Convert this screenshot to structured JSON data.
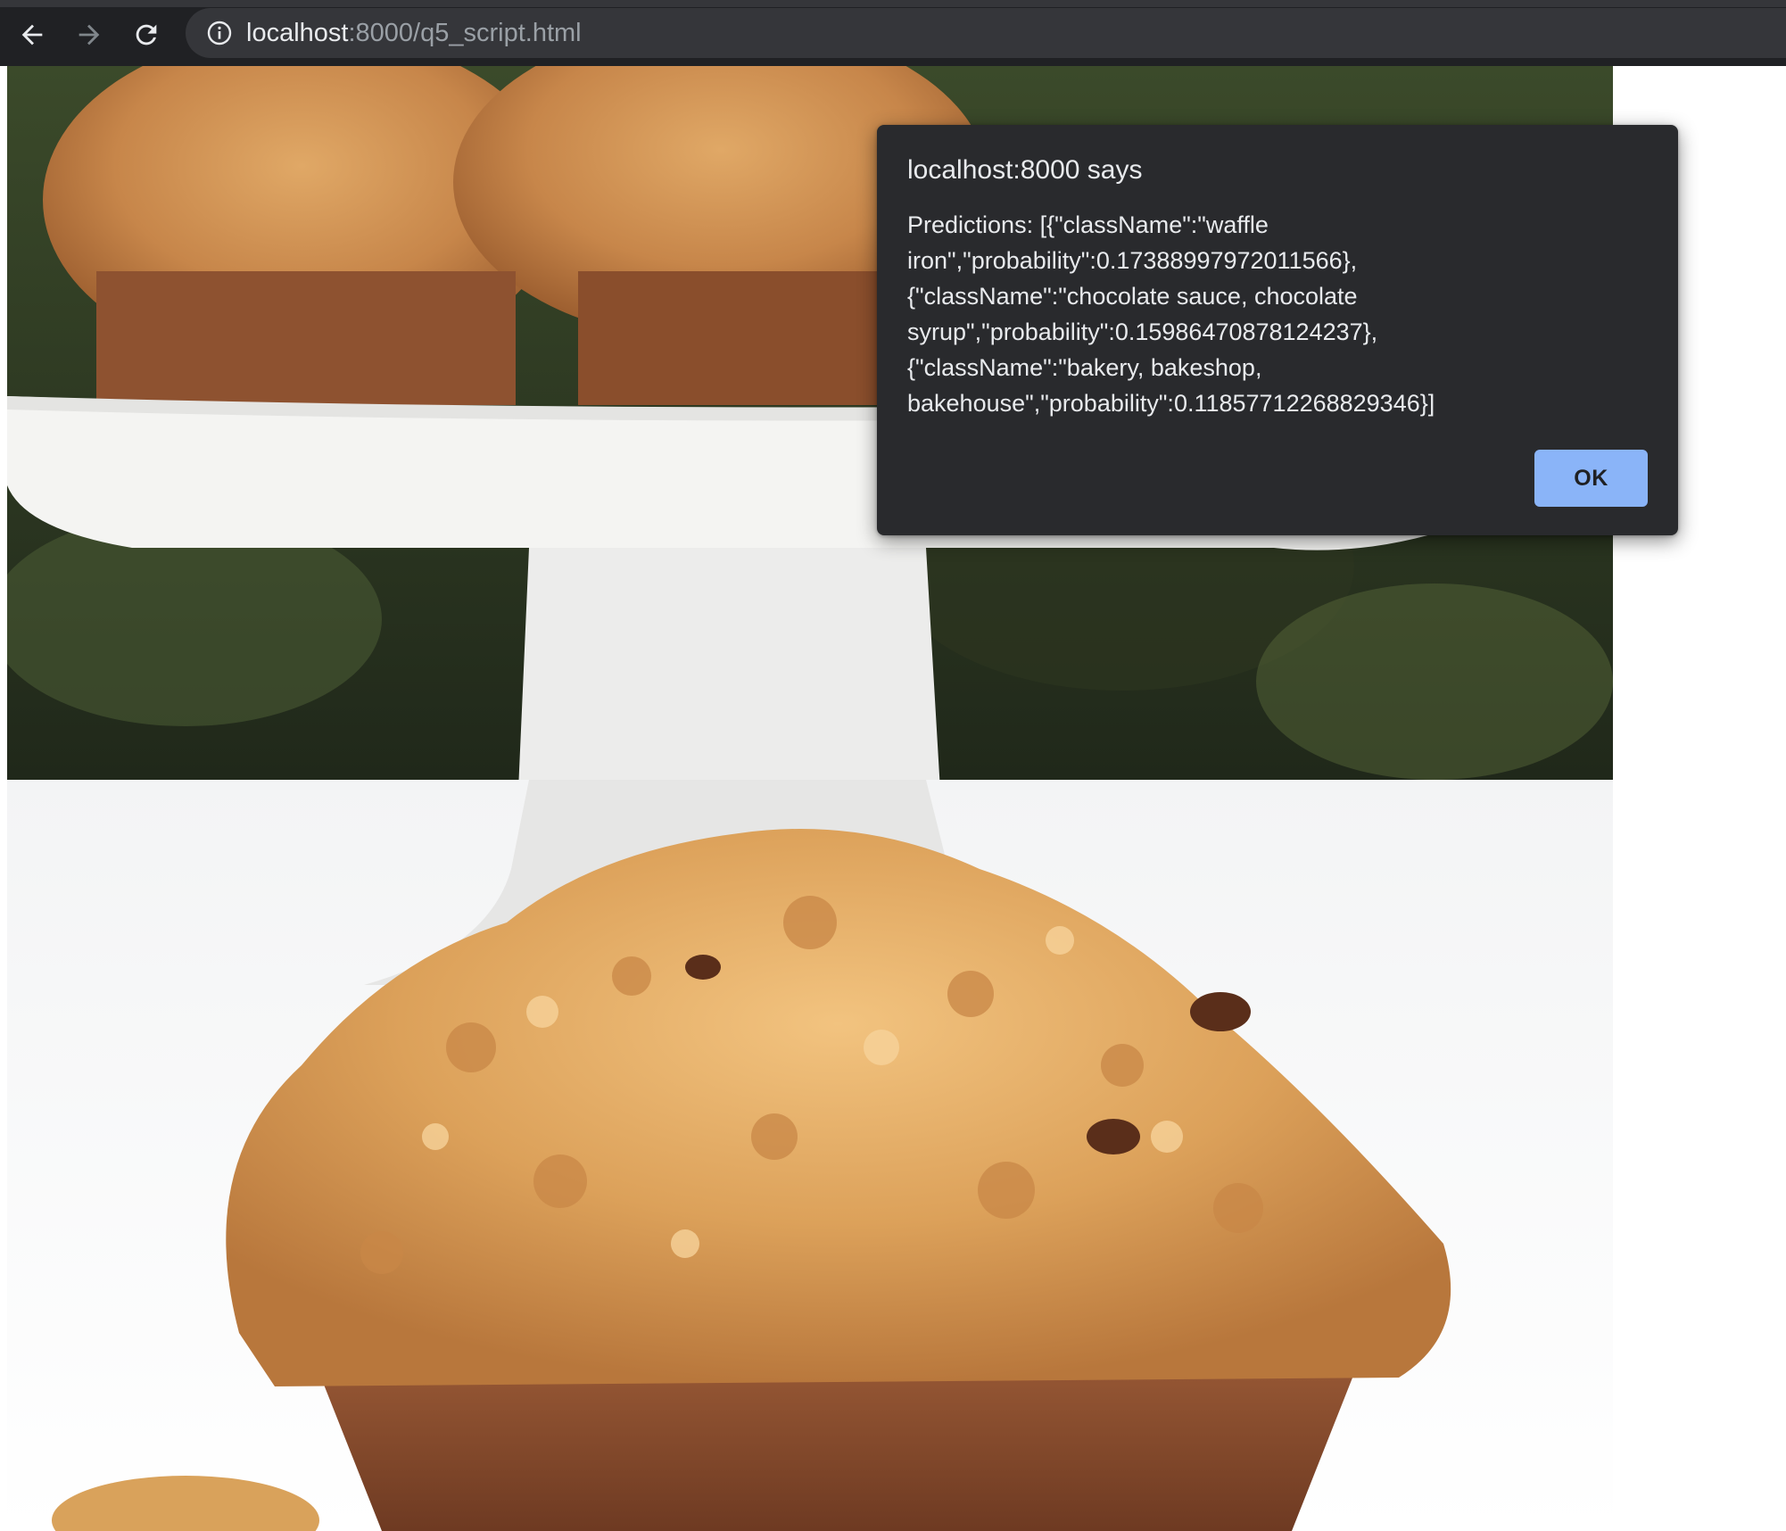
{
  "browser": {
    "url_host": "localhost",
    "url_path": ":8000/q5_script.html",
    "icons": {
      "back": "arrow-left-icon",
      "forward": "arrow-right-icon",
      "reload": "reload-icon",
      "site_info": "info-icon"
    }
  },
  "dialog": {
    "title": "localhost:8000 says",
    "message_lines": [
      "Predictions: [{\"className\":\"waffle",
      "iron\",\"probability\":0.17388997972011566},",
      "{\"className\":\"chocolate sauce, chocolate",
      "syrup\",\"probability\":0.15986470878124237},",
      "{\"className\":\"bakery, bakeshop,",
      "bakehouse\",\"probability\":0.11857712268829346}]"
    ],
    "ok_label": "OK"
  },
  "colors": {
    "toolbar": "#202124",
    "omnibox": "#35363a",
    "dialog_bg": "#292a2d",
    "accent": "#8ab4f8"
  }
}
